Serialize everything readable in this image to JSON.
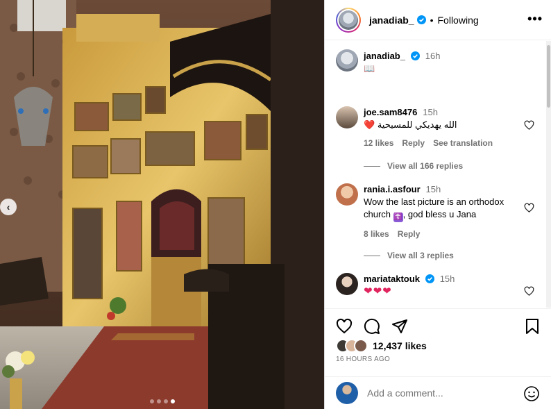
{
  "post": {
    "username": "janadiab_",
    "separator": "•",
    "follow_status": "Following",
    "more_label": "•••",
    "caption_time": "16h",
    "caption_text": "📖"
  },
  "media": {
    "prev_label": "‹",
    "dots_total": 4,
    "dot_active": 4
  },
  "comments": [
    {
      "user": "joe.sam8476",
      "time": "15h",
      "text_emoji": "❤️",
      "text": "الله يهديكي للمسيحية",
      "likes": "12 likes",
      "reply": "Reply",
      "translate": "See translation",
      "view_replies": "View all 166 replies"
    },
    {
      "user": "rania.i.asfour",
      "time": "15h",
      "text_a": "Wow the last picture is an orthodox church",
      "emoji": "☦️",
      "text_b": ", god bless u Jana",
      "likes": "8 likes",
      "reply": "Reply",
      "view_replies": "View all 3 replies"
    },
    {
      "user": "mariataktouk",
      "time": "15h",
      "text": "❤❤❤"
    }
  ],
  "stats": {
    "likes": "12,437 likes",
    "time_ago": "16 HOURS AGO"
  },
  "add_comment": {
    "placeholder": "Add a comment..."
  },
  "icons": {
    "like": "heart-icon",
    "comment": "comment-icon",
    "share": "share-icon",
    "save": "bookmark-icon",
    "emoji": "emoji-icon",
    "verified": "verified-badge-icon"
  },
  "colors": {
    "verified": "#0095f6",
    "heart_red": "#e0245e",
    "muted": "#737373"
  }
}
